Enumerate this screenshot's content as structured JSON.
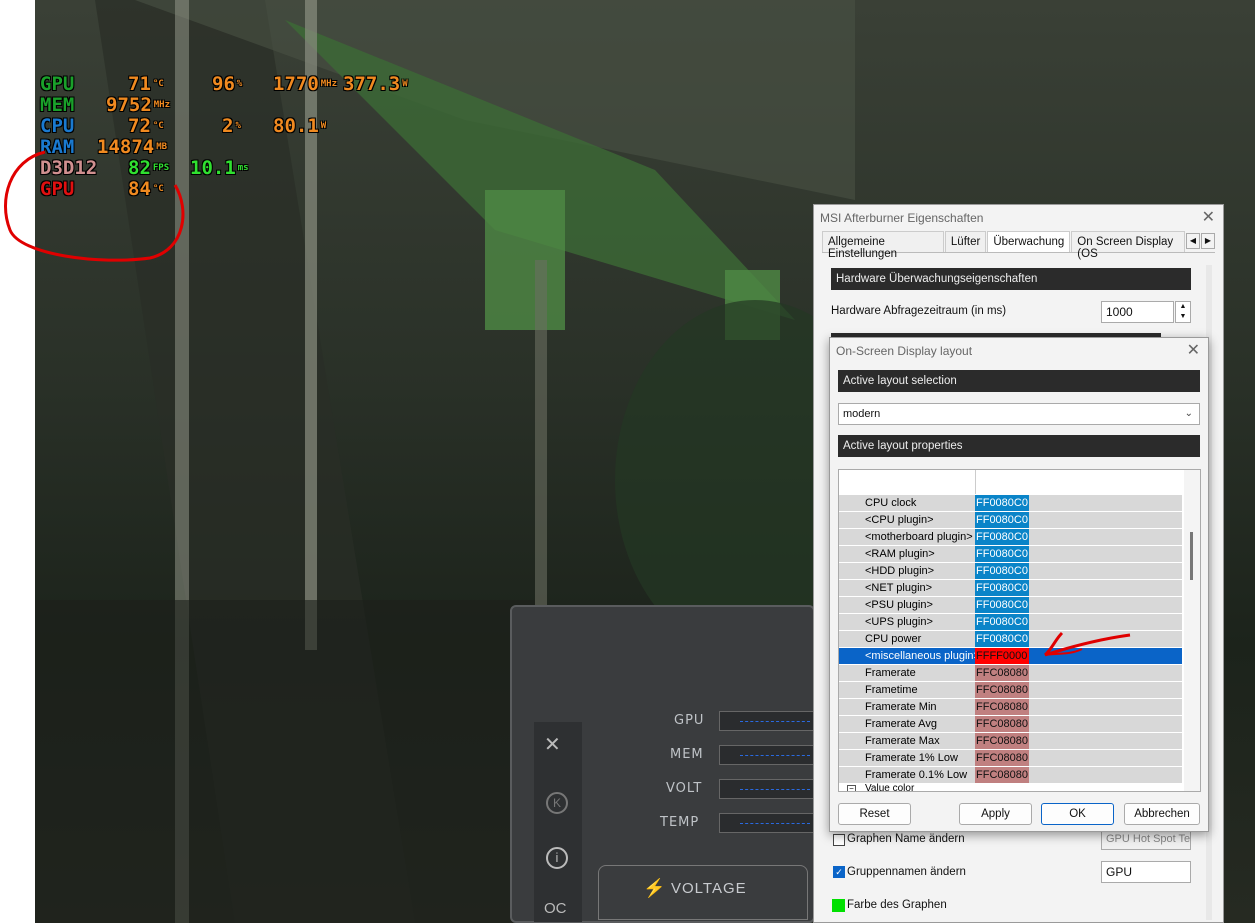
{
  "osd": {
    "rows": [
      {
        "label": "GPU",
        "v1": "71",
        "u1": "°C",
        "v2": "96",
        "u2": "%",
        "v3": "1770",
        "u3": "MHz",
        "v4": "377.3",
        "u4": "W"
      },
      {
        "label": "MEM",
        "v1": "9752",
        "u1": "MHz"
      },
      {
        "label": "CPU",
        "v1": "72",
        "u1": "°C",
        "v2": "2",
        "u2": "%",
        "v3": "80.1",
        "u3": "W"
      },
      {
        "label": "RAM",
        "v1": "14874",
        "u1": "MB"
      },
      {
        "label": "D3D12",
        "v1": "82",
        "u1": "FPS",
        "v2": "10.1",
        "u2": "ms"
      },
      {
        "label": "GPU",
        "v1": "84",
        "u1": "°C"
      }
    ]
  },
  "main_window": {
    "title": "MSI Afterburner Eigenschaften",
    "tabs": [
      "Allgemeine Einstellungen",
      "Lüfter",
      "Überwachung",
      "On Screen Display (OS"
    ],
    "section": "Hardware Überwachungseigenschaften",
    "poll_label": "Hardware Abfragezeitraum (in ms)",
    "poll_value": "1000",
    "chk1_label": "Graphen Name ändern",
    "chk1_value": "GPU Hot Spot Te",
    "chk2_label": "Gruppennamen ändern",
    "chk2_value": "GPU",
    "color_label": "Farbe des Graphen",
    "graph_color": "#00e000"
  },
  "osd_dialog": {
    "title": "On-Screen Display layout",
    "sel_head": "Active layout selection",
    "layout": "modern",
    "prop_head": "Active layout properties",
    "rows": [
      {
        "label": "CPU clock",
        "value": "FF0080C0",
        "color": "#0a84c8"
      },
      {
        "label": "<CPU plugin>",
        "value": "FF0080C0",
        "color": "#0a84c8"
      },
      {
        "label": "<motherboard plugin>",
        "value": "FF0080C0",
        "color": "#0a84c8"
      },
      {
        "label": "<RAM plugin>",
        "value": "FF0080C0",
        "color": "#0a84c8"
      },
      {
        "label": "<HDD plugin>",
        "value": "FF0080C0",
        "color": "#0a84c8"
      },
      {
        "label": "<NET plugin>",
        "value": "FF0080C0",
        "color": "#0a84c8"
      },
      {
        "label": "<PSU plugin>",
        "value": "FF0080C0",
        "color": "#0a84c8"
      },
      {
        "label": "<UPS plugin>",
        "value": "FF0080C0",
        "color": "#0a84c8"
      },
      {
        "label": "CPU power",
        "value": "FF0080C0",
        "color": "#0a84c8"
      },
      {
        "label": "<miscellaneous plugin>",
        "value": "FFFF0000",
        "color": "#ff0000"
      },
      {
        "label": "Framerate",
        "value": "FFC08080",
        "color": "#c08080"
      },
      {
        "label": "Frametime",
        "value": "FFC08080",
        "color": "#c08080"
      },
      {
        "label": "Framerate Min",
        "value": "FFC08080",
        "color": "#c08080"
      },
      {
        "label": "Framerate Avg",
        "value": "FFC08080",
        "color": "#c08080"
      },
      {
        "label": "Framerate Max",
        "value": "FFC08080",
        "color": "#c08080"
      },
      {
        "label": "Framerate 1% Low",
        "value": "FFC08080",
        "color": "#c08080"
      },
      {
        "label": "Framerate 0.1% Low",
        "value": "FFC08080",
        "color": "#c08080"
      }
    ],
    "group_label": "Value color",
    "buttons": {
      "reset": "Reset",
      "apply": "Apply",
      "ok": "OK",
      "cancel": "Abbrechen"
    }
  },
  "hud": {
    "labels": [
      "GPU",
      "MEM",
      "VOLT",
      "TEMP"
    ],
    "voltage": "VOLTAGE",
    "side_icons": [
      "msi-logo-icon",
      "k-icon",
      "info-icon",
      "oc-icon"
    ]
  }
}
